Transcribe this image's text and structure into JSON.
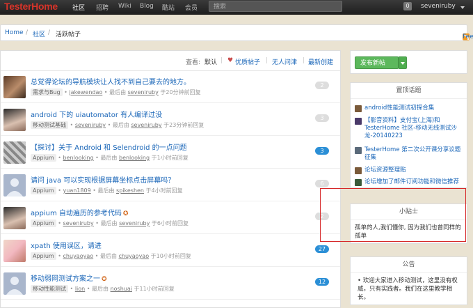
{
  "nav": {
    "logo": "TesterHome",
    "links": [
      "社区",
      "招聘",
      "Wiki",
      "Blog",
      "酷站",
      "会员"
    ],
    "search_placeholder": "搜索",
    "notification_count": "0",
    "username": "seveniruby"
  },
  "breadcrumb": {
    "home": "Home",
    "community": "社区",
    "current": "活跃帖子",
    "separator": "/",
    "feed": "Feed"
  },
  "filters": {
    "label": "查看:",
    "default": "默认",
    "excellent": "优质帖子",
    "no_reply": "无人问津",
    "latest": "最新创建",
    "separator": "|"
  },
  "topics": [
    {
      "title": "总觉得论坛的导航模块让人找不到自己要去的地方。",
      "node": "需求与Bug",
      "author": "jakewendao",
      "last_label": "最后由",
      "last_user": "seveniruby",
      "time": "于20分钟前回复",
      "count": "2",
      "hot": false,
      "award": false
    },
    {
      "title": "android 下的 uiautomator 有人编译过没",
      "node": "移动测试基础",
      "author": "seveniruby",
      "last_label": "最后由",
      "last_user": "seveniruby",
      "time": "于23分钟前回复",
      "count": "3",
      "hot": false,
      "award": false
    },
    {
      "title": "【探讨】关于 Android 和 Selendroid 的一点问题",
      "node": "Appium",
      "author": "benlooking",
      "last_label": "最后由",
      "last_user": "benlooking",
      "time": "于1小时前回复",
      "count": "3",
      "hot": true,
      "award": false
    },
    {
      "title": "请问 java 可以实现根据屏幕坐标点击屏幕吗？",
      "node": "Appium",
      "author": "yuan1809",
      "last_label": "最后由",
      "last_user": "spikeshen",
      "time": "于4小时前回复",
      "count": "6",
      "hot": false,
      "award": false
    },
    {
      "title": "appium 自动遍历的参考代码",
      "node": "Appium",
      "author": "seveniruby",
      "last_label": "最后由",
      "last_user": "seveniruby",
      "time": "于6小时前回复",
      "count": "2",
      "hot": false,
      "award": true
    },
    {
      "title": "xpath 使用误区，请进",
      "node": "Appium",
      "author": "chuyaoyao",
      "last_label": "最后由",
      "last_user": "chuyaoyao",
      "time": "于10小时前回复",
      "count": "27",
      "hot": true,
      "award": false
    },
    {
      "title": "移动弱网测试方案之一",
      "node": "移动性能测试",
      "author": "lion",
      "last_label": "最后由",
      "last_user": "noshuai",
      "time": "于11小时前回复",
      "count": "12",
      "hot": true,
      "award": true
    }
  ],
  "sidebar": {
    "new_topic": "发布新帖",
    "pinned_title": "置顶话题",
    "pinned": [
      "android性能测试初探合集",
      "【影音资料】支付宝(上海)和TesterHome 社区-移动无线测试沙龙-20140223",
      "TesterHome 第二次公开课分享议题征集",
      "论坛资源整理贴",
      "论坛增加了邮件订阅功能和微信推荐"
    ],
    "tip_title": "小贴士",
    "tip_text": "孤单的人,我们懂你, 因为我们也曾同样的孤单",
    "notice_title": "公告",
    "notice_text": "• 欢迎大家进入移动测试，这里没有权威，只有实践者。我们在这里教学相长。"
  },
  "colors": {
    "brand_red": "#d6342a",
    "link_blue": "#1a66b8",
    "hot_badge": "#2b8fd6",
    "new_button": "#5cb85c",
    "annotation_box": "#d62728"
  }
}
